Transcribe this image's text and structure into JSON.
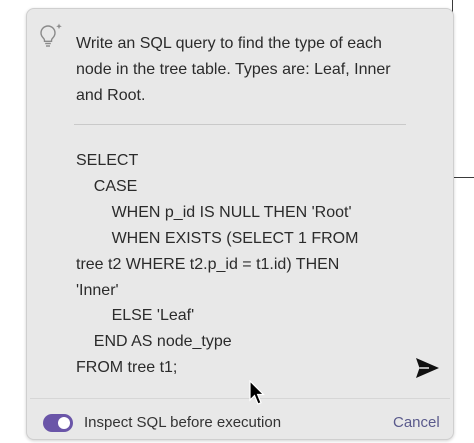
{
  "prompt": {
    "text": "Write an SQL query to find the type of each node in the tree table. Types are: Leaf, Inner and Root.",
    "icon": "lightbulb-sparkle-icon"
  },
  "sql": {
    "lines": [
      "SELECT",
      "    CASE",
      "        WHEN p_id IS NULL THEN 'Root'",
      "        WHEN EXISTS (SELECT 1 FROM",
      "tree t2 WHERE t2.p_id = t1.id) THEN",
      "'Inner'",
      "        ELSE 'Leaf'",
      "    END AS node_type",
      "FROM tree t1;"
    ]
  },
  "actions": {
    "send_icon": "send-icon"
  },
  "footer": {
    "toggle_label": "Inspect SQL before execution",
    "toggle_on": true,
    "cancel_label": "Cancel"
  },
  "colors": {
    "panel_bg": "#e8e8e8",
    "toggle_accent": "#6a55a8",
    "text": "#2b2b2b",
    "cancel": "#5a5a8c"
  }
}
